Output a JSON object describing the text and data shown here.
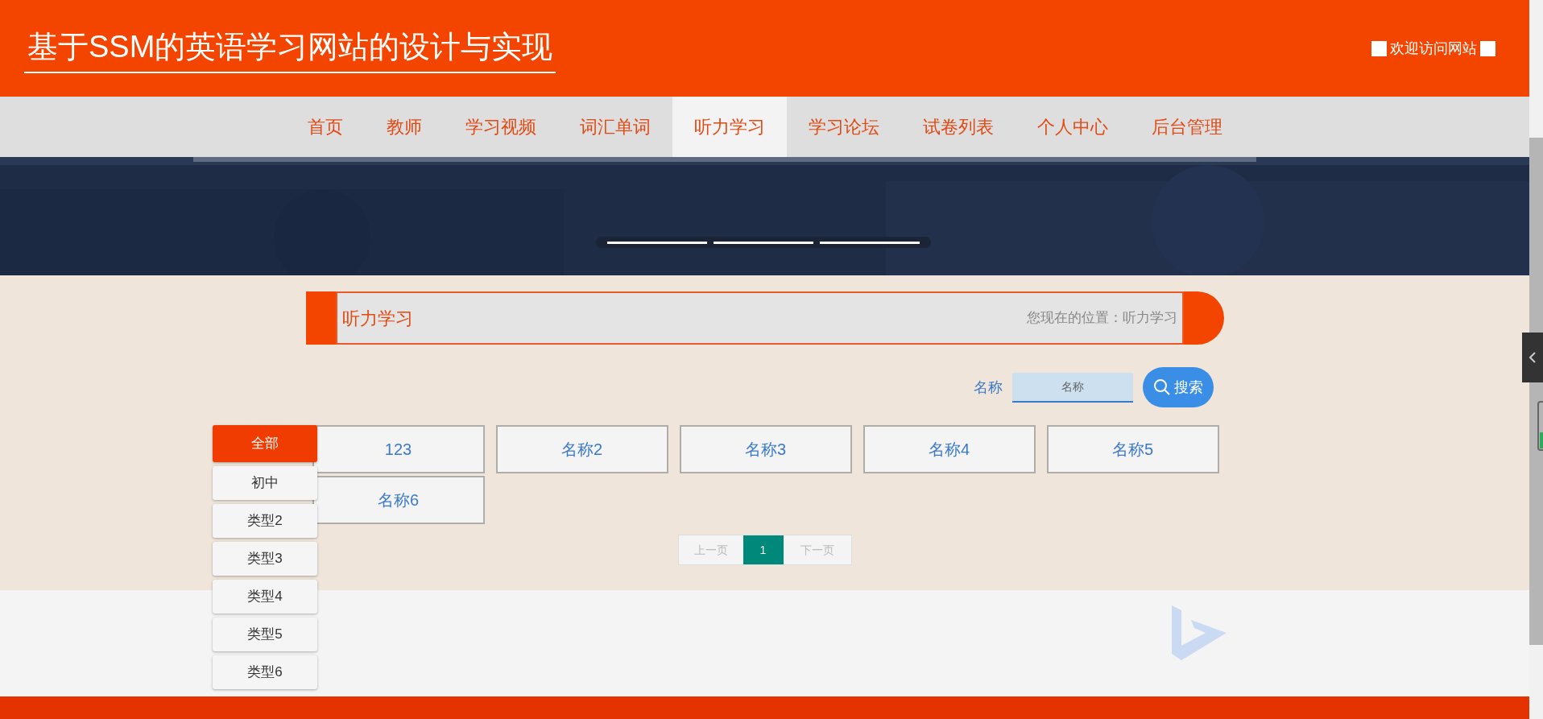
{
  "site_title": "基于SSM的英语学习网站的设计与实现",
  "welcome": "欢迎访问网站",
  "nav": [
    {
      "label": "首页",
      "selected": false
    },
    {
      "label": "教师",
      "selected": false
    },
    {
      "label": "学习视频",
      "selected": false
    },
    {
      "label": "词汇单词",
      "selected": false
    },
    {
      "label": "听力学习",
      "selected": true
    },
    {
      "label": "学习论坛",
      "selected": false
    },
    {
      "label": "试卷列表",
      "selected": false
    },
    {
      "label": "个人中心",
      "selected": false
    },
    {
      "label": "后台管理",
      "selected": false
    }
  ],
  "carousel": [
    {
      "selected": false
    },
    {
      "selected": false
    },
    {
      "selected": false
    }
  ],
  "section": {
    "title": "听力学习",
    "breadcrumb": "您现在的位置：听力学习"
  },
  "search": {
    "label": "名称",
    "placeholder": "名称",
    "button": "搜索"
  },
  "categories": [
    {
      "label": "全部",
      "selected": true
    },
    {
      "label": "初中",
      "selected": false
    },
    {
      "label": "类型2",
      "selected": false
    },
    {
      "label": "类型3",
      "selected": false
    },
    {
      "label": "类型4",
      "selected": false
    },
    {
      "label": "类型5",
      "selected": false
    },
    {
      "label": "类型6",
      "selected": false
    }
  ],
  "items": [
    "123",
    "名称2",
    "名称3",
    "名称4",
    "名称5",
    "名称6"
  ],
  "pagination": {
    "prev": "上一页",
    "pages": [
      {
        "label": "1",
        "selected": true
      }
    ],
    "next": "下一页"
  }
}
